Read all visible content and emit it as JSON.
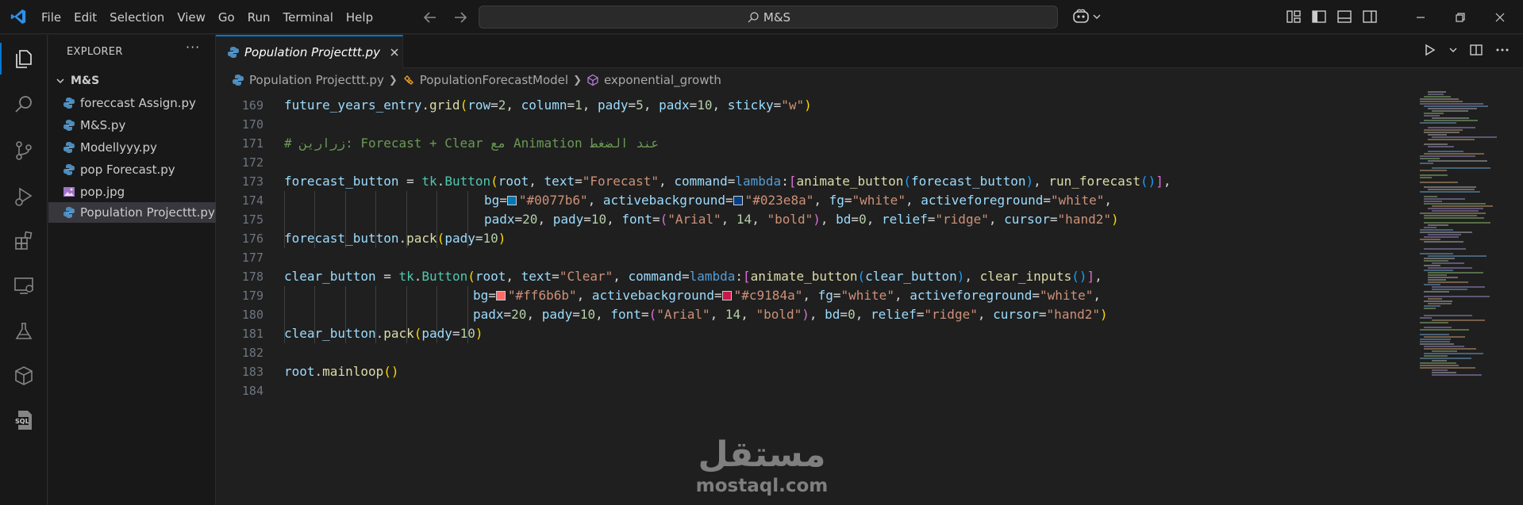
{
  "titlebar": {
    "menu": [
      "File",
      "Edit",
      "Selection",
      "View",
      "Go",
      "Run",
      "Terminal",
      "Help"
    ],
    "search_text": "M&S"
  },
  "sidebar": {
    "title": "EXPLORER",
    "more": "···",
    "folder": "M&S",
    "files": [
      {
        "name": "foreccast Assign.py",
        "icon": "python-file-icon"
      },
      {
        "name": "M&S.py",
        "icon": "python-file-icon"
      },
      {
        "name": "Modellyyy.py",
        "icon": "python-file-icon"
      },
      {
        "name": "pop Forecast.py",
        "icon": "python-file-icon"
      },
      {
        "name": "pop.jpg",
        "icon": "image-file-icon"
      },
      {
        "name": "Population Projecttt.py",
        "icon": "python-file-icon",
        "selected": true
      }
    ]
  },
  "tab": {
    "label": "Population Projecttt.py"
  },
  "breadcrumb": {
    "file": "Population Projecttt.py",
    "class": "PopulationForecastModel",
    "method": "exponential_growth"
  },
  "editor": {
    "line_numbers": [
      "169",
      "170",
      "171",
      "172",
      "173",
      "174",
      "175",
      "176",
      "177",
      "178",
      "179",
      "180",
      "181",
      "182",
      "183",
      "184"
    ],
    "lines": {
      "l169": {
        "var": "future_years_entry",
        "fn": "grid",
        "a1": "row",
        "n1": "2",
        "a2": "column",
        "n2": "1",
        "a3": "pady",
        "n3": "5",
        "a4": "padx",
        "n4": "10",
        "a5": "sticky",
        "s1": "\"w\""
      },
      "l171": {
        "comment": "# زرارين: Forecast + Clear مع Animation عند الضغط"
      },
      "l173": {
        "var": "forecast_button",
        "mod": "tk",
        "cls": "Button",
        "a0": "root",
        "a1": "text",
        "s1": "\"Forecast\"",
        "a2": "command",
        "kw": "lambda",
        "f1": "animate_button",
        "a3": "forecast_button",
        "f2": "run_forecast"
      },
      "l174": {
        "a1": "bg",
        "s1": "\"#0077b6\"",
        "a2": "activebackground",
        "s2": "\"#023e8a\"",
        "a3": "fg",
        "s3": "\"white\"",
        "a4": "activeforeground",
        "s4": "\"white\""
      },
      "l175": {
        "a1": "padx",
        "n1": "20",
        "a2": "pady",
        "n2": "10",
        "a3": "font",
        "s1": "\"Arial\"",
        "n3": "14",
        "s2": "\"bold\"",
        "a4": "bd",
        "n4": "0",
        "a5": "relief",
        "s3": "\"ridge\"",
        "a6": "cursor",
        "s4": "\"hand2\""
      },
      "l176": {
        "var": "forecast_button",
        "fn": "pack",
        "a1": "pady",
        "n1": "10"
      },
      "l178": {
        "var": "clear_button",
        "mod": "tk",
        "cls": "Button",
        "a0": "root",
        "a1": "text",
        "s1": "\"Clear\"",
        "a2": "command",
        "kw": "lambda",
        "f1": "animate_button",
        "a3": "clear_button",
        "f2": "clear_inputs"
      },
      "l179": {
        "a1": "bg",
        "s1": "\"#ff6b6b\"",
        "a2": "activebackground",
        "s2": "\"#c9184a\"",
        "a3": "fg",
        "s3": "\"white\"",
        "a4": "activeforeground",
        "s4": "\"white\""
      },
      "l180": {
        "a1": "padx",
        "n1": "20",
        "a2": "pady",
        "n2": "10",
        "a3": "font",
        "s1": "\"Arial\"",
        "n3": "14",
        "s2": "\"bold\"",
        "a4": "bd",
        "n4": "0",
        "a5": "relief",
        "s3": "\"ridge\"",
        "a6": "cursor",
        "s4": "\"hand2\""
      },
      "l181": {
        "var": "clear_button",
        "fn": "pack",
        "a1": "pady",
        "n1": "10"
      },
      "l183": {
        "var": "root",
        "fn": "mainloop"
      }
    },
    "swatch_colors": {
      "forecast_bg": "#0077b6",
      "forecast_active": "#023e8a",
      "clear_bg": "#ff6b6b",
      "clear_active": "#c9184a"
    }
  },
  "watermark": {
    "arabic": "مستقل",
    "latin": "mostaql.com"
  },
  "theme": {
    "accent": "#0078d4",
    "background": "#1f1f1f",
    "sidebar_bg": "#181818"
  }
}
